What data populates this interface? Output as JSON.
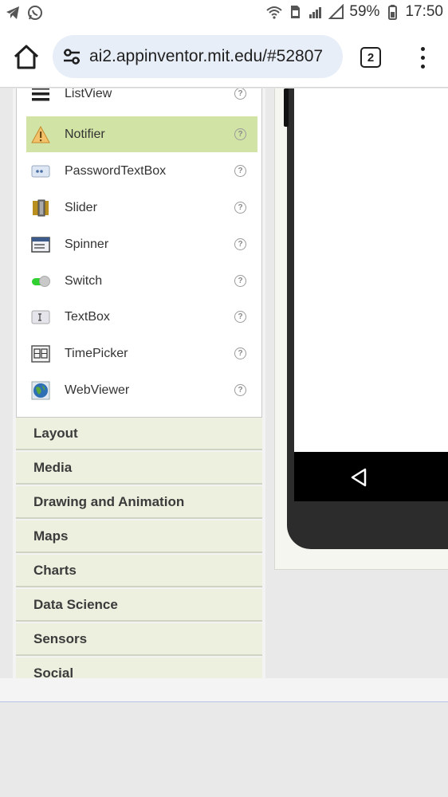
{
  "status_bar": {
    "battery": "59%",
    "time": "17:50"
  },
  "toolbar": {
    "url": "ai2.appinventor.mit.edu/#52807",
    "tab_count": "2"
  },
  "palette": {
    "items": [
      {
        "label": "ListView",
        "icon": "listview-icon",
        "selected": false
      },
      {
        "label": "Notifier",
        "icon": "notifier-warning-icon",
        "selected": true
      },
      {
        "label": "PasswordTextBox",
        "icon": "password-textbox-icon",
        "selected": false
      },
      {
        "label": "Slider",
        "icon": "slider-icon",
        "selected": false
      },
      {
        "label": "Spinner",
        "icon": "spinner-icon",
        "selected": false
      },
      {
        "label": "Switch",
        "icon": "switch-icon",
        "selected": false
      },
      {
        "label": "TextBox",
        "icon": "textbox-icon",
        "selected": false
      },
      {
        "label": "TimePicker",
        "icon": "timepicker-icon",
        "selected": false
      },
      {
        "label": "WebViewer",
        "icon": "webviewer-globe-icon",
        "selected": false
      }
    ],
    "help_glyph": "?"
  },
  "categories": [
    "Layout",
    "Media",
    "Drawing and Animation",
    "Maps",
    "Charts",
    "Data Science",
    "Sensors",
    "Social"
  ],
  "colors": {
    "selected_item": "#d1e3a5",
    "category_bg": "#edf0df",
    "url_bar_bg": "#e8eef8"
  }
}
